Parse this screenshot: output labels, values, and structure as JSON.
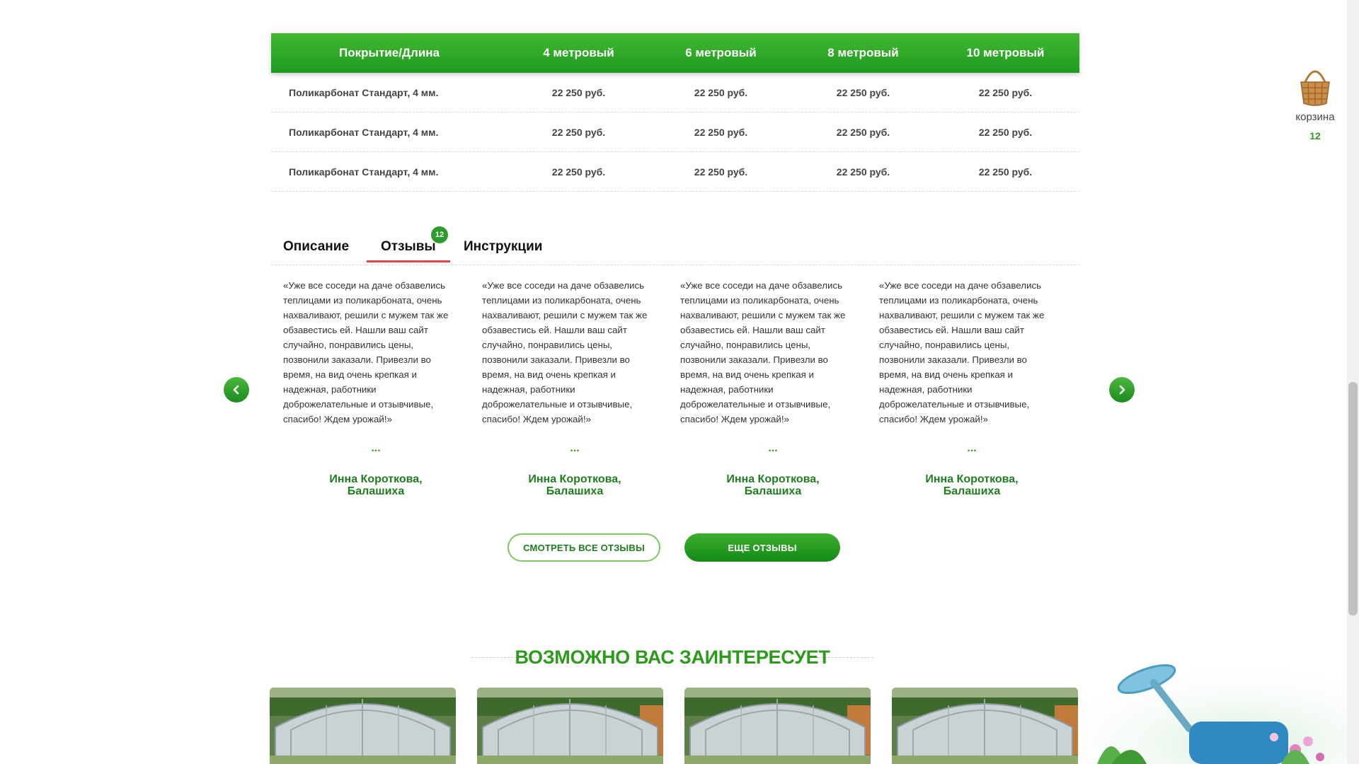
{
  "price_table": {
    "headers": [
      "Покрытие/Длина",
      "4 метровый",
      "6 метровый",
      "8 метровый",
      "10 метровый"
    ],
    "rows": [
      [
        "Поликарбонат Стандарт, 4 мм.",
        "22 250 руб.",
        "22 250 руб.",
        "22 250 руб.",
        "22 250 руб."
      ],
      [
        "Поликарбонат Стандарт, 4 мм.",
        "22 250 руб.",
        "22 250 руб.",
        "22 250 руб.",
        "22 250 руб."
      ],
      [
        "Поликарбонат Стандарт, 4 мм.",
        "22 250 руб.",
        "22 250 руб.",
        "22 250 руб.",
        "22 250 руб."
      ]
    ]
  },
  "tabs": {
    "description": "Описание",
    "reviews": "Отзывы",
    "reviews_count": "12",
    "instructions": "Инструкции",
    "active": "reviews"
  },
  "reviews": [
    {
      "text": "«Уже все соседи на даче обзавелись теплицами из поликарбоната, очень нахваливают, решили с мужем так же обзавестись ей. Нашли ваш сайт случайно, понравились цены, позвонили заказали. Привезли во время, на вид очень крепкая и надежная, работники доброжелательные и отзывчивые, спасибо! Ждем урожай!»",
      "dots": "...",
      "author": "Инна Короткова,",
      "city": "Балашиха"
    },
    {
      "text": "«Уже все соседи на даче обзавелись теплицами из поликарбоната, очень нахваливают, решили с мужем так же обзавестись ей. Нашли ваш сайт случайно, понравились цены, позвонили заказали. Привезли во время, на вид очень крепкая и надежная, работники доброжелательные и отзывчивые, спасибо! Ждем урожай!»",
      "dots": "...",
      "author": "Инна Короткова,",
      "city": "Балашиха"
    },
    {
      "text": "«Уже все соседи на даче обзавелись теплицами из поликарбоната, очень нахваливают, решили с мужем так же обзавестись ей. Нашли ваш сайт случайно, понравились цены, позвонили заказали. Привезли во время, на вид очень крепкая и надежная, работники доброжелательные и отзывчивые, спасибо! Ждем урожай!»",
      "dots": "...",
      "author": "Инна Короткова,",
      "city": "Балашиха"
    },
    {
      "text": "«Уже все соседи на даче обзавелись теплицами из поликарбоната, очень нахваливают, решили с мужем так же обзавестись ей. Нашли ваш сайт случайно, понравились цены, позвонили заказали. Привезли во время, на вид очень крепкая и надежная, работники доброжелательные и отзывчивые, спасибо! Ждем урожай!»",
      "dots": "...",
      "author": "Инна Короткова,",
      "city": "Балашиха"
    }
  ],
  "buttons": {
    "all_reviews": "СМОТРЕТЬ ВСЕ ОТЗЫВЫ",
    "more_reviews": "ЕЩЕ ОТЗЫВЫ"
  },
  "related": {
    "title": "ВОЗМОЖНО ВАС ЗАИНТЕРЕСУЕТ",
    "cards_count": 4
  },
  "cart": {
    "label": "корзина",
    "count": "12"
  },
  "icons": {
    "prev": "chevron-left-icon",
    "next": "chevron-right-icon",
    "cart": "basket-icon"
  },
  "colors": {
    "brand_green": "#2c9a1a",
    "header_green_top": "#43b931",
    "header_green_bottom": "#1e9a21",
    "active_tab_underline": "#e04747"
  }
}
